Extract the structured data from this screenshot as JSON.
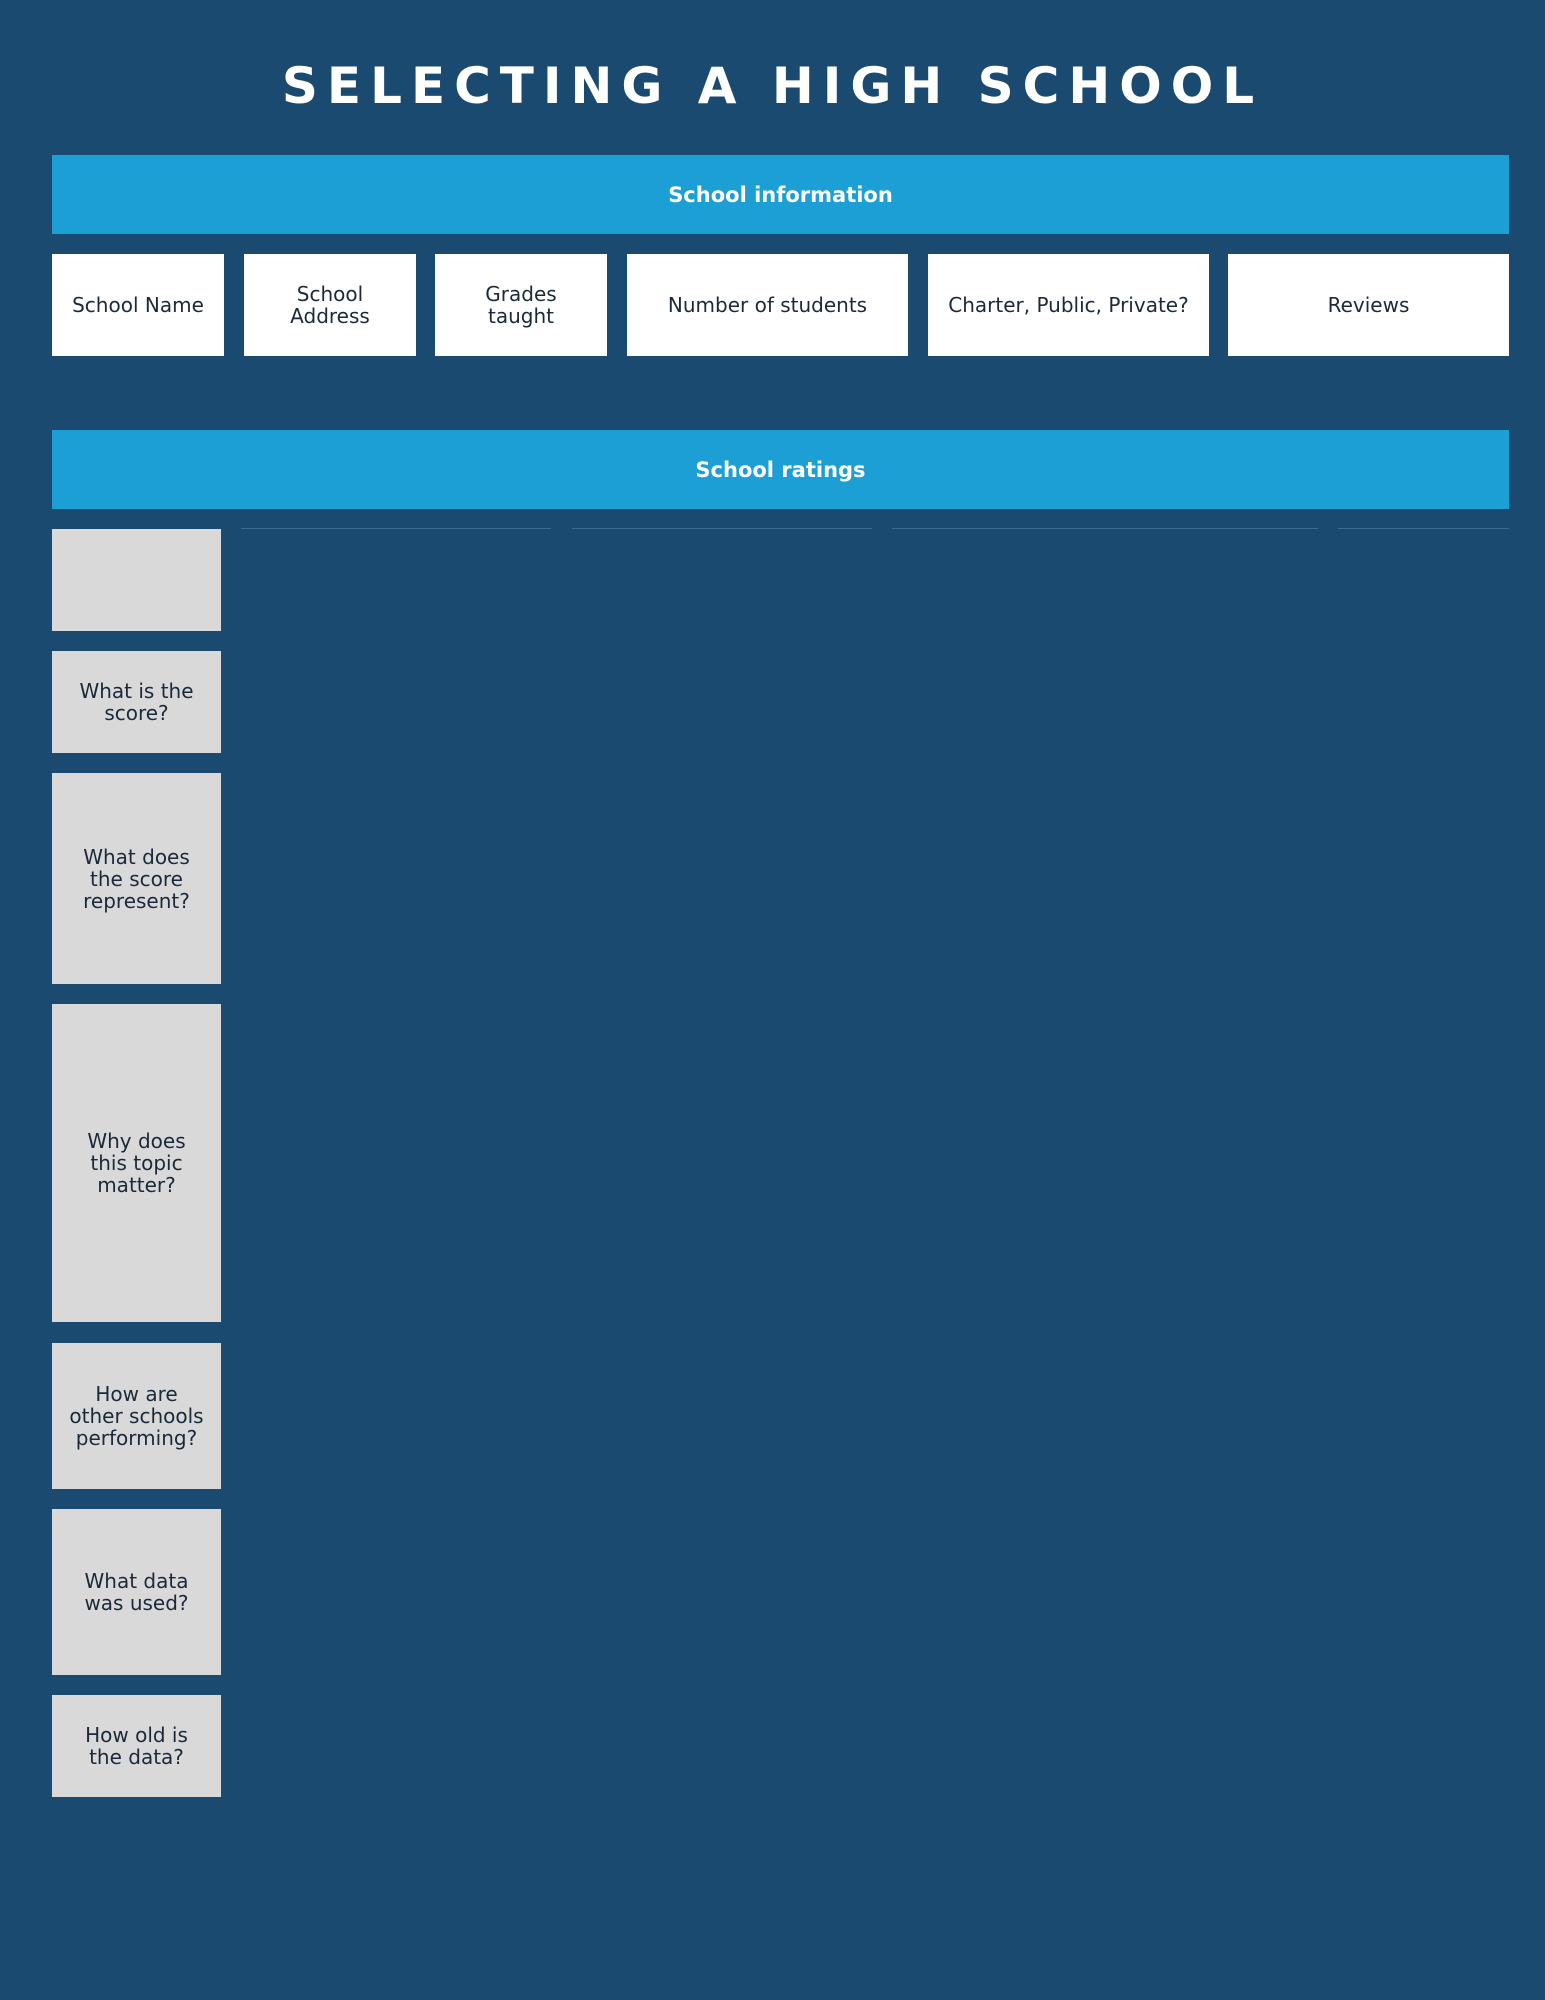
{
  "page_title": "SELECTING A HIGH SCHOOL",
  "school_information": {
    "heading": "School information",
    "fields": [
      "School Name",
      "School Address",
      "Grades taught",
      "Number of students",
      "Charter, Public, Private?",
      "Reviews"
    ]
  },
  "school_ratings": {
    "heading": "School ratings",
    "questions": [
      "",
      "What is the score?",
      "What does the score represent?",
      "Why does this topic matter?",
      "How are other schools performing?",
      "What data was used?",
      "How old is the data?"
    ]
  },
  "colors": {
    "background": "#1b4a71",
    "banner": "#1b9fd4",
    "info_box": "#ffffff",
    "rating_box": "#d9d9d9",
    "dark_text": "#1a2a3a"
  }
}
